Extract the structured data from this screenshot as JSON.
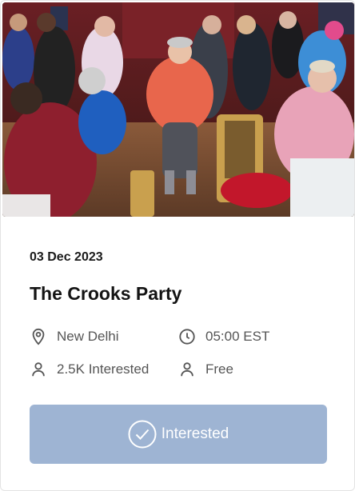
{
  "event": {
    "date": "03 Dec 2023",
    "title": "The Crooks Party",
    "location": "New Delhi",
    "time": "05:00 EST",
    "interested_count": "2.5K Interested",
    "price": "Free"
  },
  "actions": {
    "interested_label": "Interested"
  },
  "colors": {
    "button_bg": "#9eb4d3",
    "text_dark": "#141414",
    "text_muted": "#555555"
  },
  "icons": {
    "location": "map-pin-icon",
    "time": "clock-icon",
    "interested": "person-icon",
    "price": "person-icon",
    "button": "check-circle-icon"
  }
}
